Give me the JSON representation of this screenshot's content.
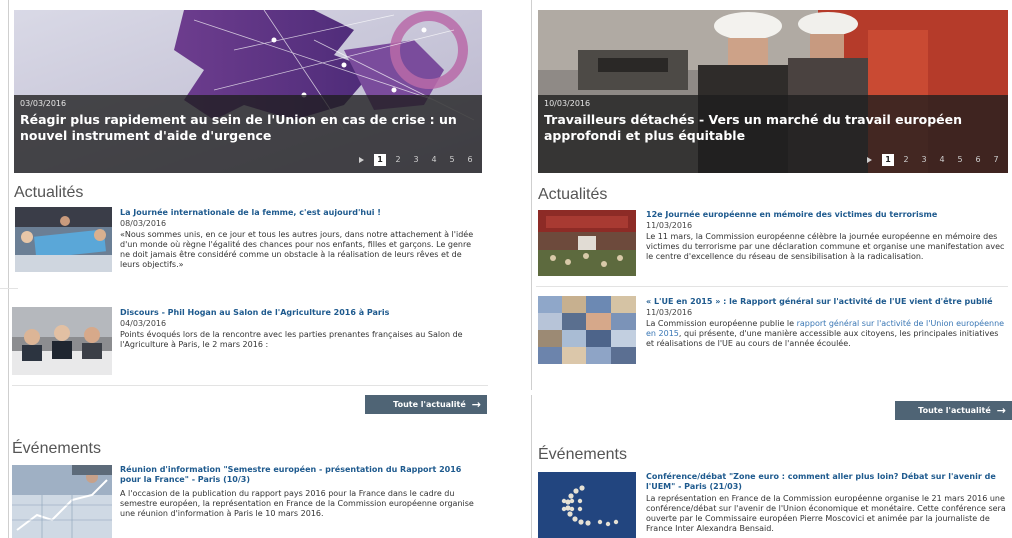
{
  "left": {
    "hero": {
      "date": "03/03/2016",
      "title": "Réagir plus rapidement au sein de l'Union en cas de crise : un nouvel instrument d'aide d'urgence",
      "pages": [
        "1",
        "2",
        "3",
        "4",
        "5",
        "6"
      ],
      "active_page": "1"
    },
    "news_heading": "Actualités",
    "news": [
      {
        "title": "La Journée internationale de la femme, c'est aujourd'hui !",
        "date": "08/03/2016",
        "text": "«Nous sommes unis, en ce jour et tous les autres jours, dans notre attachement à l'idée d'un monde où règne l'égalité des chances pour nos enfants, filles et garçons. Le genre ne doit jamais être considéré comme un obstacle à la réalisation de leurs rêves et de leurs objectifs.»"
      },
      {
        "title": "Discours - Phil Hogan au Salon de l'Agriculture 2016 à Paris",
        "date": "04/03/2016",
        "text": "Points évoqués lors de la rencontre avec les parties prenantes françaises au Salon de l'Agriculture à Paris, le 2 mars 2016 :"
      }
    ],
    "all_news_label": "Toute l'actualité",
    "events_heading": "Événements",
    "event": {
      "title": "Réunion d'information \"Semestre européen - présentation du Rapport 2016 pour la France\" - Paris (10/3)",
      "text": "A l'occasion de la publication du rapport pays 2016 pour la France dans le cadre du semestre européen, la représentation en France de la Commission européenne organise une réunion d'information à Paris le 10 mars 2016."
    }
  },
  "right": {
    "hero": {
      "date": "10/03/2016",
      "title": "Travailleurs détachés - Vers un marché du travail européen approfondi et plus équitable",
      "pages": [
        "1",
        "2",
        "3",
        "4",
        "5",
        "6",
        "7"
      ],
      "active_page": "1"
    },
    "news_heading": "Actualités",
    "news": [
      {
        "title": "12e Journée européenne en mémoire des victimes du terrorisme",
        "date": "11/03/2016",
        "text": "Le 11 mars, la Commission européenne célèbre la journée européenne en mémoire des victimes du terrorisme par une déclaration commune et organise une manifestation avec le centre d'excellence du réseau de sensibilisation à la radicalisation."
      },
      {
        "title": "« L'UE en 2015 » : le Rapport général sur l'activité de l'UE vient d'être publié",
        "date": "11/03/2016",
        "text_before": "La Commission européenne publie le ",
        "text_link": "rapport général sur l'activité de l'Union européenne en 2015",
        "text_after": ", qui présente, d'une manière accessible aux citoyens, les principales initiatives et réalisations de l'UE au cours de l'année écoulée."
      }
    ],
    "all_news_label": "Toute l'actualité",
    "events_heading": "Événements",
    "event": {
      "title": "Conférence/débat \"Zone euro : comment aller plus loin? Débat sur l'avenir de l'UEM\" - Paris (21/03)",
      "text": "La représentation en France de la Commission européenne organise le 21 mars 2016 une conférence/débat sur l'avenir de l'Union économique et monétaire. Cette conférence sera ouverte par le Commissaire européen Pierre Moscovici et animée par la journaliste de France Inter Alexandra Bensaid."
    }
  },
  "colors": {
    "link_title": "#1e5a8e",
    "button_bg": "#4f6475",
    "caption_bg": "#1e1e1e"
  }
}
